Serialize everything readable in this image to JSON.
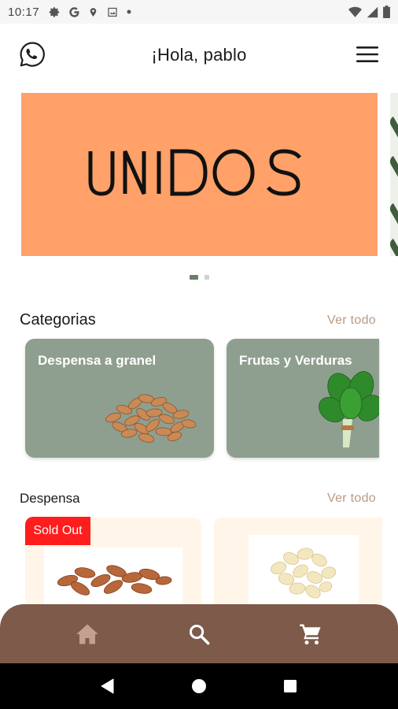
{
  "status_bar": {
    "time": "10:17",
    "icons": [
      "settings-icon",
      "google-icon",
      "location-icon",
      "image-icon",
      "dot-icon",
      "wifi-icon",
      "signal-icon",
      "battery-icon"
    ]
  },
  "header": {
    "title": "¡Hola, pablo",
    "left_icon": "whatsapp-icon",
    "right_icon": "menu-icon"
  },
  "banner": {
    "brand_text": "UNIDOS",
    "background_color": "#ffa168",
    "active_slide": 1,
    "total_slides": 2
  },
  "categories_section": {
    "title": "Categorias",
    "see_all": "Ver todo",
    "items": [
      {
        "label": "Despensa a granel",
        "image": "almonds"
      },
      {
        "label": "Frutas y Verduras",
        "image": "spinach"
      }
    ]
  },
  "pantry_section": {
    "title": "Despensa",
    "see_all": "Ver todo",
    "products": [
      {
        "badge": "Sold Out",
        "image": "almonds"
      },
      {
        "image": "sliced-almonds"
      }
    ]
  },
  "bottom_nav": {
    "items": [
      "home-icon",
      "search-icon",
      "cart-icon"
    ],
    "background_color": "#7d5a4a"
  },
  "colors": {
    "category_card": "#8f9f8f",
    "product_card": "#fff6e9",
    "accent_link": "#b99a85",
    "sold_out": "#ff1d1d"
  }
}
